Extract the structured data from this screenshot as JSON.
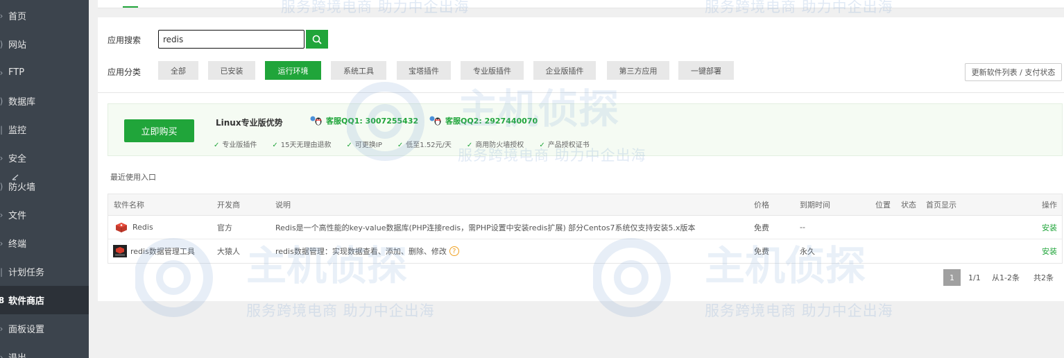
{
  "sidebar": {
    "items": [
      {
        "label": "首页",
        "active": false
      },
      {
        "label": "网站",
        "active": false
      },
      {
        "label": "FTP",
        "active": false
      },
      {
        "label": "数据库",
        "active": false
      },
      {
        "label": "监控",
        "active": false
      },
      {
        "label": "安全",
        "active": false
      },
      {
        "label": "防火墙",
        "active": false
      },
      {
        "label": "文件",
        "active": false
      },
      {
        "label": "终端",
        "active": false
      },
      {
        "label": "计划任务",
        "active": false
      },
      {
        "label": "软件商店",
        "active": true
      },
      {
        "label": "面板设置",
        "active": false
      },
      {
        "label": "退出",
        "active": false
      }
    ]
  },
  "search": {
    "label": "应用搜索",
    "value": "redis"
  },
  "categories": {
    "label": "应用分类",
    "items": [
      {
        "label": "全部",
        "active": false
      },
      {
        "label": "已安装",
        "active": false
      },
      {
        "label": "运行环境",
        "active": true
      },
      {
        "label": "系统工具",
        "active": false
      },
      {
        "label": "宝塔插件",
        "active": false
      },
      {
        "label": "专业版插件",
        "active": false
      },
      {
        "label": "企业版插件",
        "active": false
      },
      {
        "label": "第三方应用",
        "active": false
      },
      {
        "label": "一键部署",
        "active": false
      }
    ],
    "update_label": "更新软件列表 / 支付状态"
  },
  "promo": {
    "buy_label": "立即购买",
    "title": "Linux专业版优势",
    "qq1": "客服QQ1: 3007255432",
    "qq2": "客服QQ2: 2927440070",
    "features": [
      "专业版插件",
      "15天无理由退款",
      "可更换IP",
      "低至1.52元/天",
      "商用防火墙授权",
      "产品授权证书"
    ]
  },
  "recent_label": "最近使用入口",
  "table": {
    "headers": {
      "name": "软件名称",
      "developer": "开发商",
      "desc": "说明",
      "price": "价格",
      "expire": "到期时间",
      "position": "位置",
      "status": "状态",
      "homepage": "首页显示",
      "action": "操作"
    },
    "rows": [
      {
        "name": "Redis",
        "icon": "redis-cube-icon",
        "developer": "官方",
        "desc": "Redis是一个高性能的key-value数据库(PHP连接redis，需PHP设置中安装redis扩展) 部分Centos7系统仅支持安装5.x版本",
        "price": "免费",
        "expire": "--",
        "action": "安装"
      },
      {
        "name": "redis数据管理工具",
        "icon": "redis-tool-icon",
        "developer": "大猿人",
        "desc": "redis数据管理：实现数据查看、添加、删除、修改",
        "price": "免费",
        "expire": "永久",
        "action": "安装"
      }
    ]
  },
  "pager": {
    "current": "1",
    "pages": "1/1",
    "range": "从1-2条",
    "total": "共2条"
  },
  "watermark": {
    "sub": "服务跨境电商 助力中企出海",
    "big": "主机侦探"
  },
  "colors": {
    "accent": "#20a53a",
    "sidebar_bg": "#3c444d",
    "sidebar_active": "#2c3138"
  }
}
